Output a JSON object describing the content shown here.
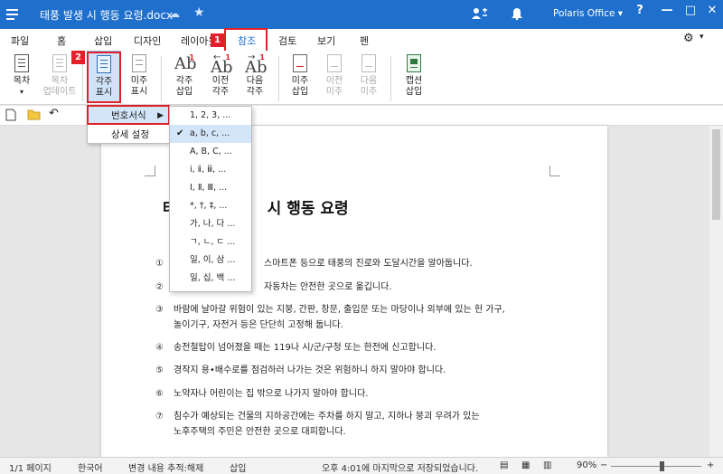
{
  "titlebar": {
    "doc_title": "태풍 발생 시 행동 요령.docx",
    "account": "Polaris Office",
    "help": "?",
    "minimize": "—",
    "maximize": "□",
    "close": "✕"
  },
  "tabs": [
    "파일",
    "홈",
    "삽입",
    "디자인",
    "레이아웃",
    "참조",
    "검토",
    "보기",
    "펜"
  ],
  "ribbon": {
    "toc": "목차",
    "toc_update_1": "목차",
    "toc_update_2": "업데이트",
    "footnote_show_1": "각주",
    "footnote_show_2": "표시",
    "endnote_show_1": "미주",
    "endnote_show_2": "표시",
    "fn_insert_1": "각주",
    "fn_insert_2": "삽입",
    "fn_prev_1": "이전",
    "fn_prev_2": "각주",
    "fn_next_1": "다음",
    "fn_next_2": "각주",
    "en_insert_1": "미주",
    "en_insert_2": "삽입",
    "en_prev_1": "이전",
    "en_prev_2": "미주",
    "en_next_1": "다음",
    "en_next_2": "미주",
    "caption_1": "캡션",
    "caption_2": "삽입",
    "ab": "Ab",
    "sup": "1"
  },
  "badges": [
    "1",
    "2",
    "3"
  ],
  "menu": {
    "number_format": "번호서식",
    "detail_settings": "상세 설정",
    "formats": [
      "1, 2, 3, ...",
      "a, b, c, ...",
      "A, B, C, ...",
      "ⅰ, ⅱ, ⅲ, ...",
      "Ⅰ, Ⅱ, Ⅲ, ...",
      "*, †, ‡, ...",
      "가, 나, 다 ...",
      "ㄱ, ㄴ, ㄷ ...",
      "일, 이, 삼 ...",
      "일, 십, 백 ..."
    ],
    "selected_index": 1
  },
  "document": {
    "heading_start": "태",
    "heading_end": "시 행동 요령",
    "items": [
      {
        "num": "①",
        "text": "스마트폰 등으로 태풍의 진로와 도달시간을 알아둡니다."
      },
      {
        "num": "②",
        "text": "자동차는 안전한 곳으로 옮깁니다."
      },
      {
        "num": "③",
        "text": "바람에 날아갈 위험이 있는 지붕, 간판, 창문, 출입문 또는 마당이나 외부에 있는 헌 가구,",
        "cont": "놀이기구, 자전거 등은 단단히 고정해 둡니다."
      },
      {
        "num": "④",
        "text": "송전철탑이 넘어졌을 때는 119나 시/군/구청 또는 한전에 신고합니다."
      },
      {
        "num": "⑤",
        "text": "경작지 용•배수로를 점검하러 나가는 것은 위험하니 하지 말아야 합니다."
      },
      {
        "num": "⑥",
        "text": "노약자나 어린이는 집 밖으로 나가지 말아야 합니다."
      },
      {
        "num": "⑦",
        "text": "침수가 예상되는 건물의 지하공간에는 주차를 하지 말고, 지하나 붕괴 우려가 있는",
        "cont": "노후주택의 주민은 안전한 곳으로 대피합니다."
      }
    ]
  },
  "status": {
    "page": "1/1 페이지",
    "language": "한국어",
    "track_changes": "변경 내용 추적:해제",
    "insert_mode": "삽입",
    "saved_time": "오후 4:01에 마지막으로 저장되었습니다.",
    "zoom": "90%",
    "minus": "−",
    "plus": "+"
  },
  "colors": {
    "brand": "#1f6fcd",
    "highlight": "#e2202a"
  }
}
